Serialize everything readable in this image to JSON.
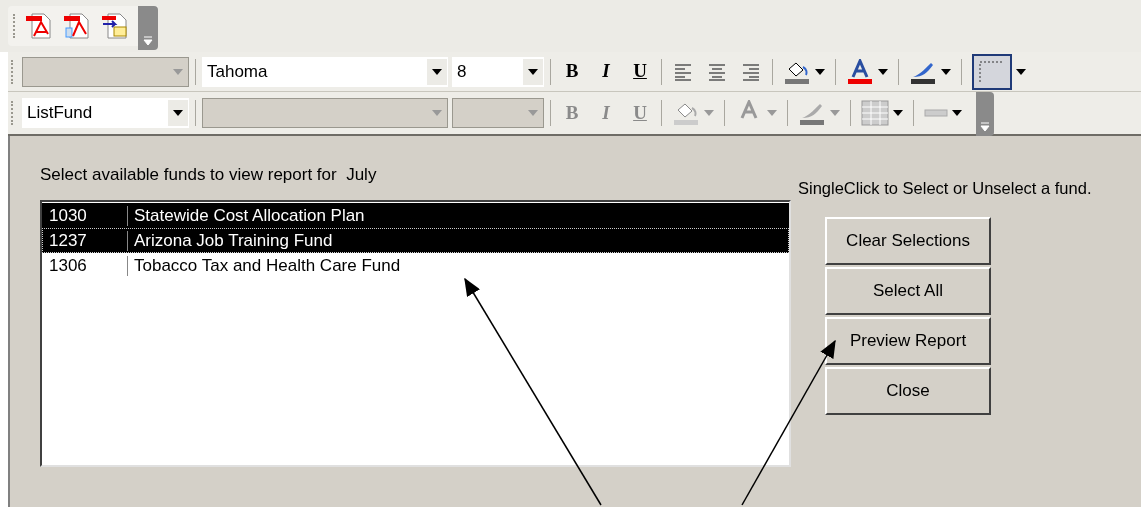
{
  "pdf_toolbar": {
    "buttons": [
      {
        "kind": "pdf"
      },
      {
        "kind": "pdf-doc"
      },
      {
        "kind": "pdf-mail"
      }
    ]
  },
  "formatting_toolbar": {
    "disabled": false,
    "object_combo": {
      "disabled": true
    },
    "font_combo": {
      "value": "Tahoma",
      "disabled": false
    },
    "size_combo": {
      "value": "8",
      "disabled": false
    },
    "style_buttons": [
      "B",
      "I",
      "U"
    ]
  },
  "format_toolbar": {
    "disabled": true,
    "object_combo": {
      "value": "ListFund",
      "disabled": false
    },
    "font_combo": {
      "disabled": true
    },
    "size_combo": {
      "disabled": true
    },
    "style_buttons": [
      "B",
      "I",
      "U"
    ]
  },
  "form": {
    "prompt": "Select available funds to view report for  July",
    "hint": "SingleClick to Select or Unselect a fund.",
    "funds": [
      {
        "code": "1030",
        "name": "Statewide Cost Allocation Plan",
        "selected": true,
        "focused": false
      },
      {
        "code": "1237",
        "name": "Arizona Job Training Fund",
        "selected": true,
        "focused": true
      },
      {
        "code": "1306",
        "name": "Tobacco Tax and Health Care Fund",
        "selected": false,
        "focused": false
      }
    ],
    "buttons": [
      "Clear Selections",
      "Select All",
      "Preview Report",
      "Close"
    ]
  }
}
